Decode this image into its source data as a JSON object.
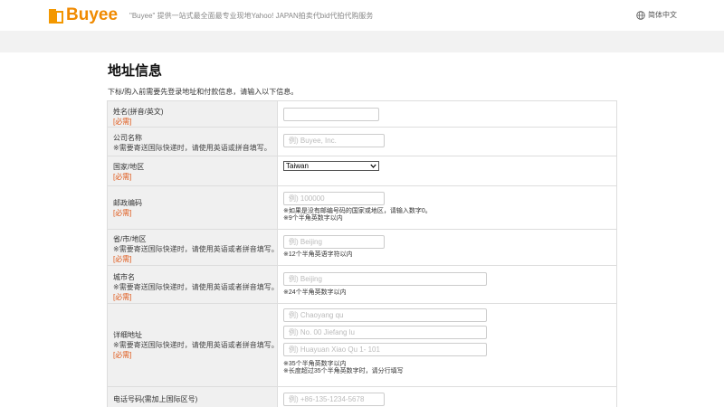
{
  "header": {
    "logo_text": "Buyee",
    "tagline": "\"Buyee\" 提供一站式最全面最专业现地Yahoo! JAPAN拍卖代bid代拍代购服务",
    "language": "简体中文"
  },
  "page": {
    "title": "地址信息",
    "intro": "下标/购入前需要先登录地址和付款信息，请输入以下信息。"
  },
  "required_label": "[必需]",
  "fields": {
    "name": {
      "label": "姓名(拼音/英文)",
      "value": ""
    },
    "company": {
      "label": "公司名称",
      "note": "※需要寄送国际快递时，请使用英语或拼音填写。",
      "placeholder": "例) Buyee, Inc."
    },
    "country": {
      "label": "国家/地区",
      "selected": "Taiwan"
    },
    "postal": {
      "label": "邮政编码",
      "placeholder": "例) 100000",
      "hint1": "※如果是没有邮编号码的国家或地区，请输入数字0。",
      "hint2": "※9个半角英数字以内"
    },
    "province": {
      "label": "省/市/地区",
      "note": "※需要寄送国际快递时，请使用英语或者拼音填写。",
      "placeholder": "例) Beijing",
      "hint1": "※12个半角英语字符以内"
    },
    "city": {
      "label": "城市名",
      "note": "※需要寄送国际快递时，请使用英语或者拼音填写。",
      "placeholder": "例) Beijing",
      "hint1": "※24个半角英数字以内"
    },
    "address": {
      "label": "详细地址",
      "note": "※需要寄送国际快递时，请使用英语或者拼音填写。",
      "placeholder1": "例) Chaoyang qu",
      "placeholder2": "例) No. 00 Jiefang lu",
      "placeholder3": "例) Huayuan Xiao Qu  1- 101",
      "hint1": "※35个半角英数字以内",
      "hint2": "※长度超过35个半角英数字时，请分行填写"
    },
    "phone": {
      "label": "电话号码(需加上国际区号)",
      "placeholder": "例) +86-135-1234-5678"
    }
  },
  "colors": {
    "brand": "#f08a00",
    "required": "#e05a1c",
    "label_bg": "#f0f0f0"
  },
  "icons": {
    "language": "globe-icon",
    "select": "chevron-down-icon"
  }
}
